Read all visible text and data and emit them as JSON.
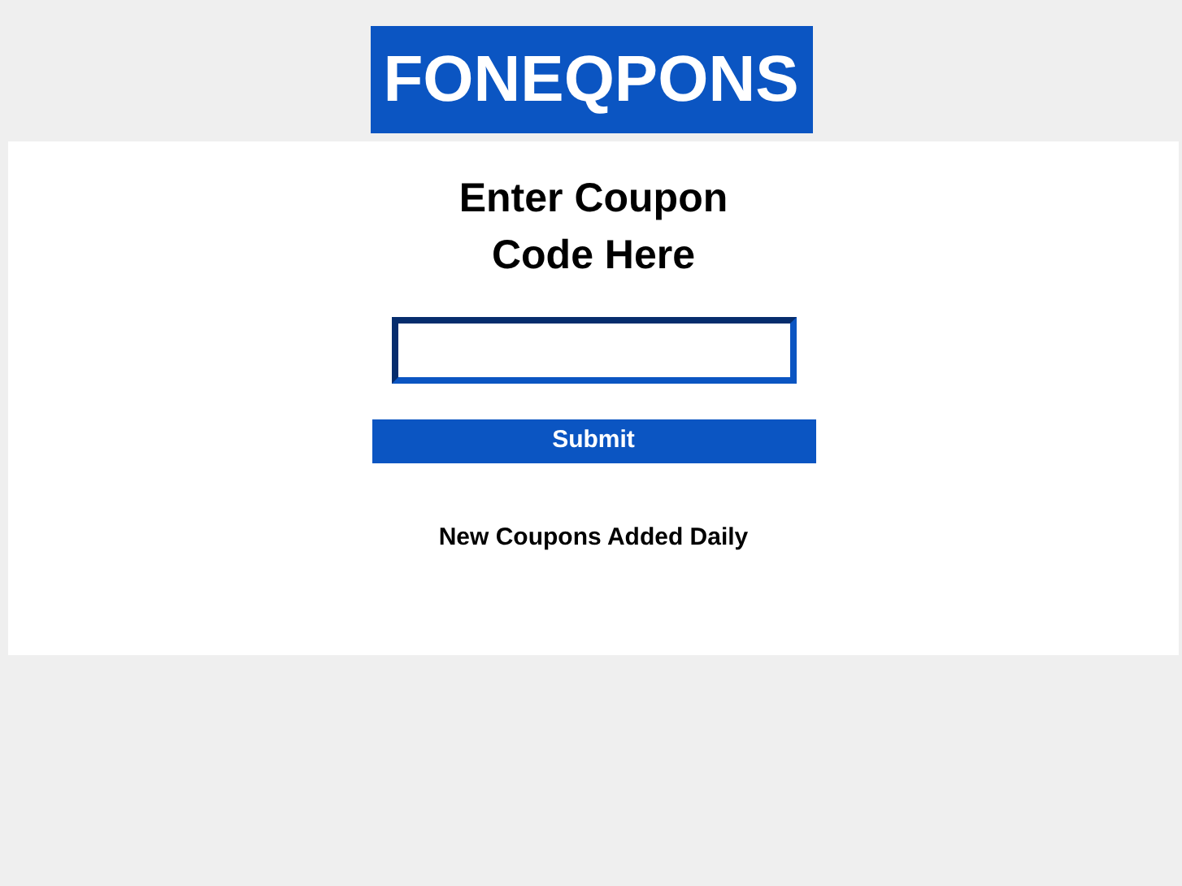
{
  "logo": {
    "text": "FONEQPONS"
  },
  "heading": [
    "Enter Coupon",
    "Code Here"
  ],
  "submit_button": {
    "label": "Submit"
  },
  "note": "New Coupons Added Daily"
}
